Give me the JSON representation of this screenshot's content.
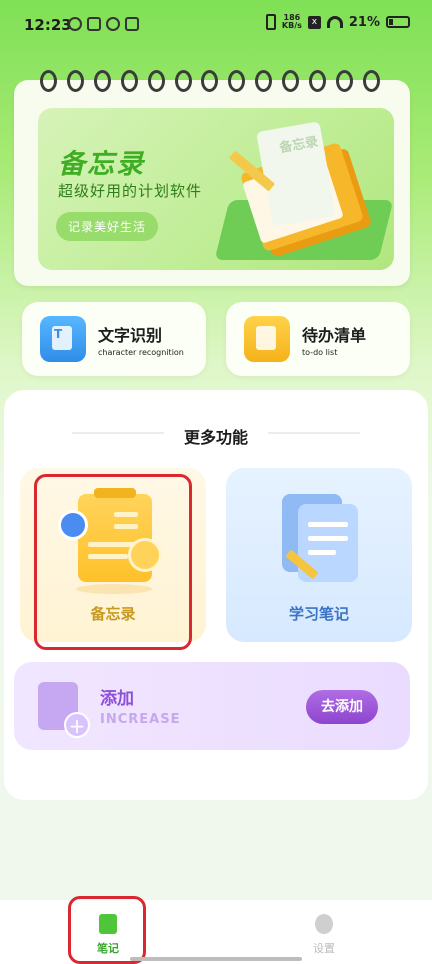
{
  "status_bar": {
    "time": "12:23",
    "speed_top": "186",
    "speed_bottom": "KB/s",
    "battery": "21%"
  },
  "banner": {
    "title": "备忘录",
    "subtitle": "超级好用的计划软件",
    "pill": "记录美好生活",
    "note_text": "备忘录"
  },
  "features": [
    {
      "title": "文字识别",
      "subtitle": "character recognition",
      "icon": "text-recognition-icon",
      "color": "#3f9df2"
    },
    {
      "title": "待办清单",
      "subtitle": "to-do list",
      "icon": "todo-list-icon",
      "color": "#f7bf2c"
    }
  ],
  "more": {
    "title": "更多功能",
    "memo_label": "备忘录",
    "study_label": "学习笔记"
  },
  "add_card": {
    "title": "添加",
    "subtitle": "INCREASE",
    "button": "去添加"
  },
  "bottom_nav": {
    "notes": "笔记",
    "settings": "设置"
  },
  "colors": {
    "accent_green": "#4fc63a",
    "highlight_red": "#d9282f",
    "purple": "#8f4fd8"
  }
}
